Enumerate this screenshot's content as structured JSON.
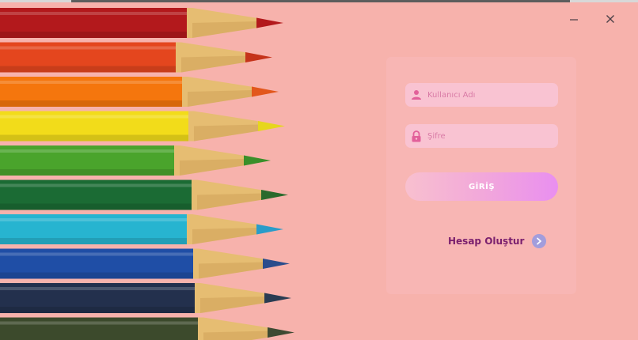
{
  "login": {
    "username_placeholder": "Kullanıcı Adı",
    "password_placeholder": "Şifre",
    "login_button_label": "GİRİŞ",
    "create_account_label": "Hesap Oluştur"
  },
  "window_controls": {
    "minimize_icon": "minimize-icon",
    "close_icon": "close-icon"
  },
  "colors": {
    "background": "#f7b2ac",
    "field": "#f9c3d2",
    "accent_text": "#7a1f6e",
    "button_gradient": [
      "#f8c0cf",
      "#f2a8da",
      "#e98ff0"
    ]
  },
  "pencils": [
    {
      "body": "#b3191c",
      "lead": "#b3191c"
    },
    {
      "body": "#e4461e",
      "lead": "#c5331a"
    },
    {
      "body": "#f5760d",
      "lead": "#e2571c"
    },
    {
      "body": "#f2dc1a",
      "lead": "#e6d61d"
    },
    {
      "body": "#4aa42c",
      "lead": "#3a8f2a"
    },
    {
      "body": "#1b6b34",
      "lead": "#2a6a2c"
    },
    {
      "body": "#27b4d0",
      "lead": "#2a9cc9"
    },
    {
      "body": "#1f4ea6",
      "lead": "#2a4d8c"
    },
    {
      "body": "#23304d",
      "lead": "#2a3c52"
    },
    {
      "body": "#3c4a2c",
      "lead": "#3e4a32"
    }
  ]
}
